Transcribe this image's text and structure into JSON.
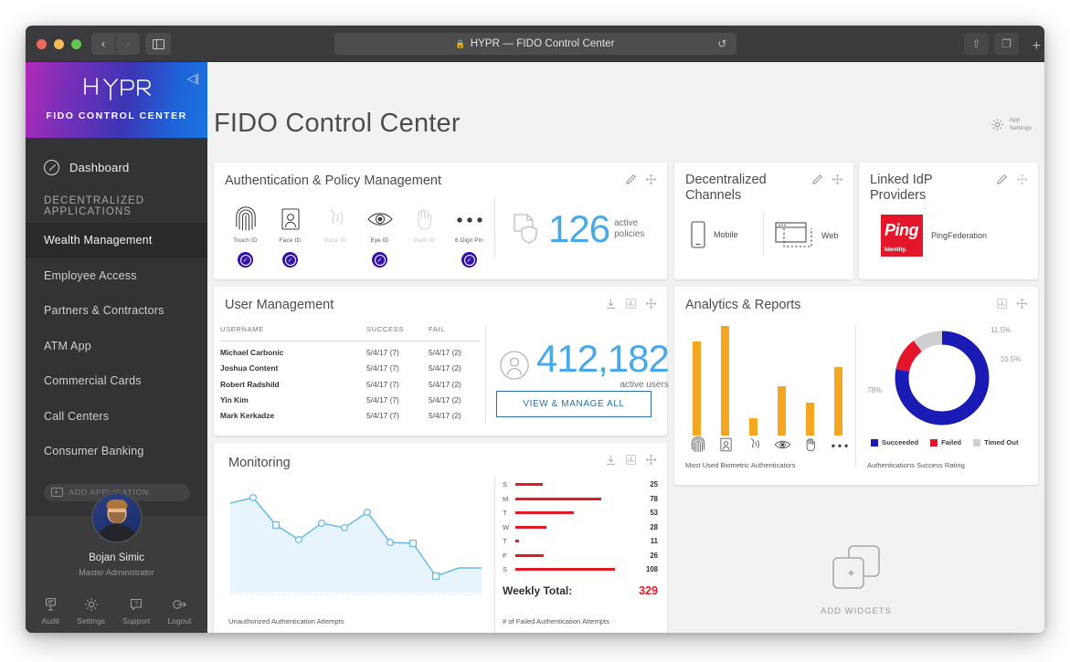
{
  "titlebar": {
    "url_text": "HYPR — FIDO Control Center",
    "lock_icon": "lock-icon",
    "reload_icon": "reload-icon",
    "back_icon": "‹",
    "forward_icon": "›",
    "share_icon": "share-icon",
    "tabs_icon": "tabs-icon",
    "newtab_icon": "+"
  },
  "sidebar": {
    "logo": "HYPR",
    "brand_subtitle": "FIDO CONTROL CENTER",
    "collapse_icon": "collapse-sidebar-icon",
    "dashboard_label": "Dashboard",
    "section_label": "DECENTRALIZED APPLICATIONS",
    "apps": [
      {
        "label": "Wealth Management",
        "active": true
      },
      {
        "label": "Employee Access",
        "active": false
      },
      {
        "label": "Partners & Contractors",
        "active": false
      },
      {
        "label": "ATM App",
        "active": false
      },
      {
        "label": "Commercial Cards",
        "active": false
      },
      {
        "label": "Call Centers",
        "active": false
      },
      {
        "label": "Consumer Banking",
        "active": false
      }
    ],
    "add_application_label": "ADD APPLICATION",
    "profile": {
      "name": "Bojan Simic",
      "role": "Master Administrator",
      "tools": [
        {
          "label": "Audit",
          "icon": "audit-icon"
        },
        {
          "label": "Settings",
          "icon": "gear-icon"
        },
        {
          "label": "Support",
          "icon": "support-icon"
        },
        {
          "label": "Logout",
          "icon": "logout-icon"
        }
      ]
    }
  },
  "header": {
    "title": "FIDO Control Center",
    "app_settings_line1": "App",
    "app_settings_line2": "Settings",
    "gear_icon": "gear-icon"
  },
  "cards": {
    "auth_policy": {
      "title": "Authentication & Policy Management",
      "edit_icon": "pencil-icon",
      "move_icon": "move-icon",
      "methods": [
        {
          "label": "Touch ID",
          "icon": "fingerprint-icon",
          "enabled": true
        },
        {
          "label": "Face ID",
          "icon": "face-icon",
          "enabled": true
        },
        {
          "label": "Voice ID",
          "icon": "voice-icon",
          "enabled": false
        },
        {
          "label": "Eye ID",
          "icon": "eye-icon",
          "enabled": true
        },
        {
          "label": "Palm ID",
          "icon": "palm-icon",
          "enabled": false
        },
        {
          "label": "6 Digit Pin",
          "icon": "pin-dots-icon",
          "enabled": true
        }
      ],
      "stat_value": "126",
      "stat_label_line1": "active",
      "stat_label_line2": "policies",
      "stat_icon": "policy-shield-icon"
    },
    "channels": {
      "title": "Decentralized Channels",
      "edit_icon": "pencil-icon",
      "move_icon": "move-icon",
      "items": [
        {
          "label": "Mobile",
          "icon": "mobile-icon"
        },
        {
          "label": "Web",
          "icon": "browser-icon"
        }
      ]
    },
    "idp": {
      "title": "Linked IdP Providers",
      "edit_icon": "pencil-icon",
      "move_icon": "move-icon",
      "provider_name": "PingFederation",
      "provider_logo_line1": "Ping",
      "provider_logo_line2": "Identity.",
      "provider_color": "#E4172A"
    },
    "user_management": {
      "title": "User Management",
      "download_icon": "download-icon",
      "chart_icon": "bar-chart-icon",
      "move_icon": "move-icon",
      "columns": [
        "USERNAME",
        "SUCCESS",
        "FAIL"
      ],
      "rows": [
        [
          "Michael Carbonic",
          "5/4/17 (7)",
          "5/4/17 (2)"
        ],
        [
          "Joshua Content",
          "5/4/17 (7)",
          "5/4/17 (2)"
        ],
        [
          "Robert Radshild",
          "5/4/17 (7)",
          "5/4/17 (2)"
        ],
        [
          "Yin Kim",
          "5/4/17 (7)",
          "5/4/17 (2)"
        ],
        [
          "Mark Kerkadze",
          "5/4/17 (7)",
          "5/4/17 (2)"
        ]
      ],
      "stat_value": "412,182",
      "stat_label": "active users",
      "stat_icon": "user-circle-icon",
      "button_label": "VIEW & MANAGE ALL"
    },
    "analytics": {
      "title": "Analytics & Reports",
      "chart_icon": "bar-chart-icon",
      "move_icon": "move-icon",
      "left_caption": "Most Used Biometric Authenticators",
      "right_caption": "Authentications Success Rating"
    },
    "monitoring": {
      "title": "Monitoring",
      "download_icon": "download-icon",
      "chart_icon": "bar-chart-icon",
      "move_icon": "move-icon",
      "left_caption": "Unauthorized Authentication Attempts",
      "right_caption": "# of Failed Authentication Attempts",
      "weekly_total_label": "Weekly Total:",
      "weekly_total_value": "329",
      "total_color": "#E01B24"
    },
    "add_widgets": {
      "label": "ADD WIDGETS",
      "icon": "add-widgets-icon"
    }
  },
  "chart_data": [
    {
      "type": "bar",
      "title": "Most Used Biometric Authenticators",
      "categories": [
        "Touch ID",
        "Face ID",
        "Voice ID",
        "Eye ID",
        "Palm ID",
        "6 Digit Pin"
      ],
      "values": [
        86,
        100,
        16,
        45,
        30,
        62
      ],
      "color": "#F5A623",
      "ylim": [
        0,
        100
      ],
      "grid": false,
      "xlabel": "",
      "ylabel": ""
    },
    {
      "type": "pie",
      "title": "Authentications Success Rating",
      "labels": [
        "Succeeded",
        "Failed",
        "Timed Out"
      ],
      "values": [
        78,
        11.5,
        10.5
      ],
      "display_labels": [
        "78%",
        "11.5%",
        "10.5%"
      ],
      "colors": [
        "#1A1AB5",
        "#E4172A",
        "#CFCFD2"
      ],
      "legend": [
        "Succeeded",
        "Failed",
        "Timed Out"
      ],
      "legend_position": "bottom",
      "donut": true
    },
    {
      "type": "area",
      "title": "Unauthorized Authentication Attempts",
      "x": [
        1,
        2,
        3,
        4,
        5,
        6,
        7,
        8,
        9,
        10,
        11,
        12
      ],
      "values": [
        72,
        78,
        51,
        38,
        56,
        51,
        65,
        36,
        35,
        12,
        20,
        20
      ],
      "color": "#69B9E8",
      "fill": "#E8F4FB",
      "ylim": [
        0,
        90
      ],
      "grid": false,
      "xlabel": "",
      "ylabel": ""
    },
    {
      "type": "bar",
      "title": "# of Failed Authentication Attempts",
      "orientation": "horizontal",
      "categories": [
        "S",
        "M",
        "T",
        "W",
        "T",
        "F",
        "S"
      ],
      "values": [
        25,
        78,
        53,
        28,
        11,
        26,
        108
      ],
      "color": "#E01B24",
      "xlim": [
        0,
        108
      ],
      "total_label": "Weekly Total:",
      "total": 329
    }
  ]
}
